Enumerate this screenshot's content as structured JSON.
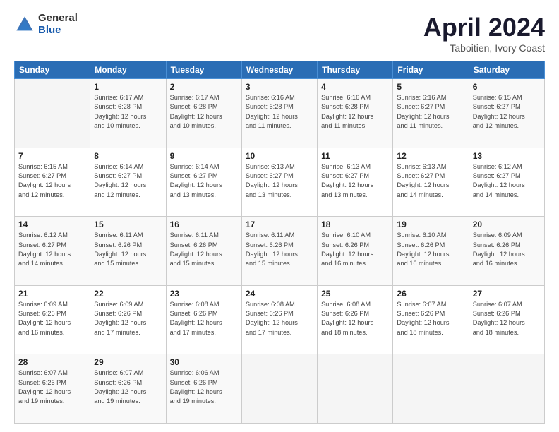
{
  "header": {
    "logo_general": "General",
    "logo_blue": "Blue",
    "month_title": "April 2024",
    "subtitle": "Taboitien, Ivory Coast"
  },
  "calendar": {
    "days_of_week": [
      "Sunday",
      "Monday",
      "Tuesday",
      "Wednesday",
      "Thursday",
      "Friday",
      "Saturday"
    ],
    "weeks": [
      [
        {
          "day": "",
          "info": ""
        },
        {
          "day": "1",
          "info": "Sunrise: 6:17 AM\nSunset: 6:28 PM\nDaylight: 12 hours\nand 10 minutes."
        },
        {
          "day": "2",
          "info": "Sunrise: 6:17 AM\nSunset: 6:28 PM\nDaylight: 12 hours\nand 10 minutes."
        },
        {
          "day": "3",
          "info": "Sunrise: 6:16 AM\nSunset: 6:28 PM\nDaylight: 12 hours\nand 11 minutes."
        },
        {
          "day": "4",
          "info": "Sunrise: 6:16 AM\nSunset: 6:28 PM\nDaylight: 12 hours\nand 11 minutes."
        },
        {
          "day": "5",
          "info": "Sunrise: 6:16 AM\nSunset: 6:27 PM\nDaylight: 12 hours\nand 11 minutes."
        },
        {
          "day": "6",
          "info": "Sunrise: 6:15 AM\nSunset: 6:27 PM\nDaylight: 12 hours\nand 12 minutes."
        }
      ],
      [
        {
          "day": "7",
          "info": "Sunrise: 6:15 AM\nSunset: 6:27 PM\nDaylight: 12 hours\nand 12 minutes."
        },
        {
          "day": "8",
          "info": "Sunrise: 6:14 AM\nSunset: 6:27 PM\nDaylight: 12 hours\nand 12 minutes."
        },
        {
          "day": "9",
          "info": "Sunrise: 6:14 AM\nSunset: 6:27 PM\nDaylight: 12 hours\nand 13 minutes."
        },
        {
          "day": "10",
          "info": "Sunrise: 6:13 AM\nSunset: 6:27 PM\nDaylight: 12 hours\nand 13 minutes."
        },
        {
          "day": "11",
          "info": "Sunrise: 6:13 AM\nSunset: 6:27 PM\nDaylight: 12 hours\nand 13 minutes."
        },
        {
          "day": "12",
          "info": "Sunrise: 6:13 AM\nSunset: 6:27 PM\nDaylight: 12 hours\nand 14 minutes."
        },
        {
          "day": "13",
          "info": "Sunrise: 6:12 AM\nSunset: 6:27 PM\nDaylight: 12 hours\nand 14 minutes."
        }
      ],
      [
        {
          "day": "14",
          "info": "Sunrise: 6:12 AM\nSunset: 6:27 PM\nDaylight: 12 hours\nand 14 minutes."
        },
        {
          "day": "15",
          "info": "Sunrise: 6:11 AM\nSunset: 6:26 PM\nDaylight: 12 hours\nand 15 minutes."
        },
        {
          "day": "16",
          "info": "Sunrise: 6:11 AM\nSunset: 6:26 PM\nDaylight: 12 hours\nand 15 minutes."
        },
        {
          "day": "17",
          "info": "Sunrise: 6:11 AM\nSunset: 6:26 PM\nDaylight: 12 hours\nand 15 minutes."
        },
        {
          "day": "18",
          "info": "Sunrise: 6:10 AM\nSunset: 6:26 PM\nDaylight: 12 hours\nand 16 minutes."
        },
        {
          "day": "19",
          "info": "Sunrise: 6:10 AM\nSunset: 6:26 PM\nDaylight: 12 hours\nand 16 minutes."
        },
        {
          "day": "20",
          "info": "Sunrise: 6:09 AM\nSunset: 6:26 PM\nDaylight: 12 hours\nand 16 minutes."
        }
      ],
      [
        {
          "day": "21",
          "info": "Sunrise: 6:09 AM\nSunset: 6:26 PM\nDaylight: 12 hours\nand 16 minutes."
        },
        {
          "day": "22",
          "info": "Sunrise: 6:09 AM\nSunset: 6:26 PM\nDaylight: 12 hours\nand 17 minutes."
        },
        {
          "day": "23",
          "info": "Sunrise: 6:08 AM\nSunset: 6:26 PM\nDaylight: 12 hours\nand 17 minutes."
        },
        {
          "day": "24",
          "info": "Sunrise: 6:08 AM\nSunset: 6:26 PM\nDaylight: 12 hours\nand 17 minutes."
        },
        {
          "day": "25",
          "info": "Sunrise: 6:08 AM\nSunset: 6:26 PM\nDaylight: 12 hours\nand 18 minutes."
        },
        {
          "day": "26",
          "info": "Sunrise: 6:07 AM\nSunset: 6:26 PM\nDaylight: 12 hours\nand 18 minutes."
        },
        {
          "day": "27",
          "info": "Sunrise: 6:07 AM\nSunset: 6:26 PM\nDaylight: 12 hours\nand 18 minutes."
        }
      ],
      [
        {
          "day": "28",
          "info": "Sunrise: 6:07 AM\nSunset: 6:26 PM\nDaylight: 12 hours\nand 19 minutes."
        },
        {
          "day": "29",
          "info": "Sunrise: 6:07 AM\nSunset: 6:26 PM\nDaylight: 12 hours\nand 19 minutes."
        },
        {
          "day": "30",
          "info": "Sunrise: 6:06 AM\nSunset: 6:26 PM\nDaylight: 12 hours\nand 19 minutes."
        },
        {
          "day": "",
          "info": ""
        },
        {
          "day": "",
          "info": ""
        },
        {
          "day": "",
          "info": ""
        },
        {
          "day": "",
          "info": ""
        }
      ]
    ]
  }
}
